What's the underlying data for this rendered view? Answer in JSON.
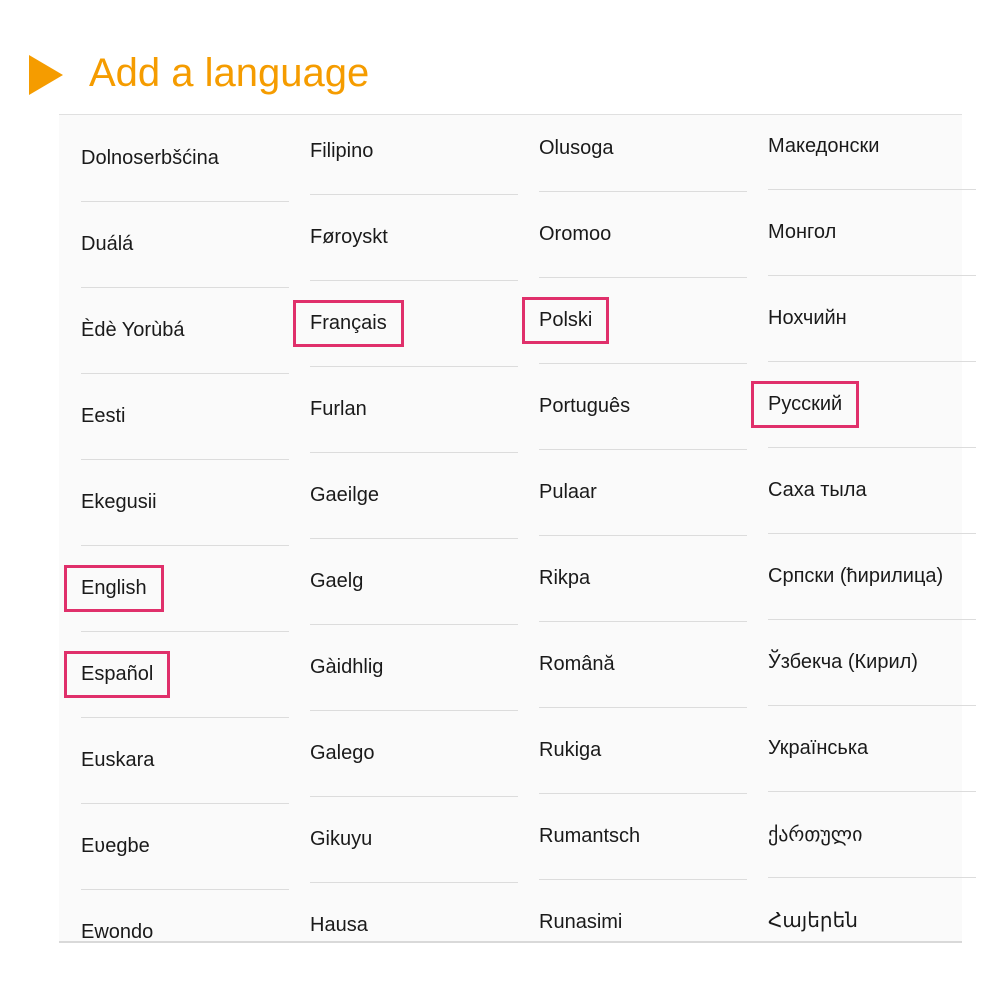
{
  "header": {
    "title": "Add a language",
    "accent_color": "#f59c00",
    "icon": "play-arrow-icon"
  },
  "highlight_color": "#e0306b",
  "languages": {
    "col1": [
      "Dolnoserbšćina",
      "Duálá",
      "Èdè Yorùbá",
      "Eesti",
      "Ekegusii",
      "English",
      "Español",
      "Euskara",
      "Eʋegbe",
      "Ewondo"
    ],
    "col2": [
      "Filipino",
      "Føroyskt",
      "Français",
      "Furlan",
      "Gaeilge",
      "Gaelg",
      "Gàidhlig",
      "Galego",
      "Gikuyu",
      "Hausa"
    ],
    "col3": [
      "Olusoga",
      "Oromoo",
      "Polski",
      "Português",
      "Pulaar",
      "Rikpa",
      "Română",
      "Rukiga",
      "Rumantsch",
      "Runasimi"
    ],
    "col4": [
      "Македонски",
      "Монгол",
      "Нохчийн",
      "Русский",
      "Саха тыла",
      "Српски (ћирилица)",
      "Ўзбекча (Кирил)",
      "Українська",
      "ქართული",
      "Հայերեն"
    ]
  },
  "highlighted": [
    "English",
    "Español",
    "Français",
    "Polski",
    "Русский"
  ]
}
